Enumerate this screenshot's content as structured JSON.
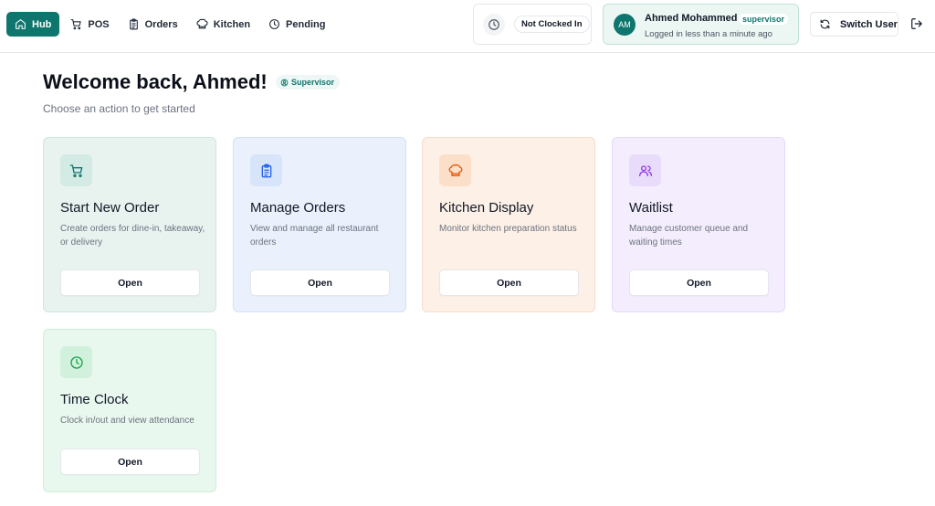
{
  "nav": {
    "items": [
      {
        "label": "Hub",
        "icon": "home-icon",
        "active": true
      },
      {
        "label": "POS",
        "icon": "cart-icon",
        "active": false
      },
      {
        "label": "Orders",
        "icon": "clipboard-icon",
        "active": false
      },
      {
        "label": "Kitchen",
        "icon": "chef-hat-icon",
        "active": false
      },
      {
        "label": "Pending",
        "icon": "clock-icon",
        "active": false
      }
    ]
  },
  "clock_status": {
    "label": "Not Clocked In",
    "icon": "clock-icon"
  },
  "user": {
    "initials": "AM",
    "name": "Ahmed Mohammed",
    "role": "supervisor",
    "login_info": "Logged in less than a minute ago"
  },
  "header_actions": {
    "switch_user_label": "Switch User",
    "logout_icon": "logout-icon"
  },
  "welcome": {
    "title": "Welcome back, Ahmed!",
    "role_badge": "Supervisor",
    "subtitle": "Choose an action to get started"
  },
  "cards": [
    {
      "title": "Start New Order",
      "description": "Create orders for dine-in, takeaway, or delivery",
      "button": "Open",
      "icon": "cart-icon",
      "accent": "#0f766e"
    },
    {
      "title": "Manage Orders",
      "description": "View and manage all restaurant orders",
      "button": "Open",
      "icon": "clipboard-icon",
      "accent": "#2563eb"
    },
    {
      "title": "Kitchen Display",
      "description": "Monitor kitchen preparation status",
      "button": "Open",
      "icon": "chef-hat-icon",
      "accent": "#ea580c"
    },
    {
      "title": "Waitlist",
      "description": "Manage customer queue and waiting times",
      "button": "Open",
      "icon": "users-icon",
      "accent": "#9333ea"
    },
    {
      "title": "Time Clock",
      "description": "Clock in/out and view attendance",
      "button": "Open",
      "icon": "clock-icon",
      "accent": "#16a34a"
    }
  ],
  "colors": {
    "primary": "#0f766e",
    "background": "#ffffff",
    "muted_text": "#6b7280"
  }
}
